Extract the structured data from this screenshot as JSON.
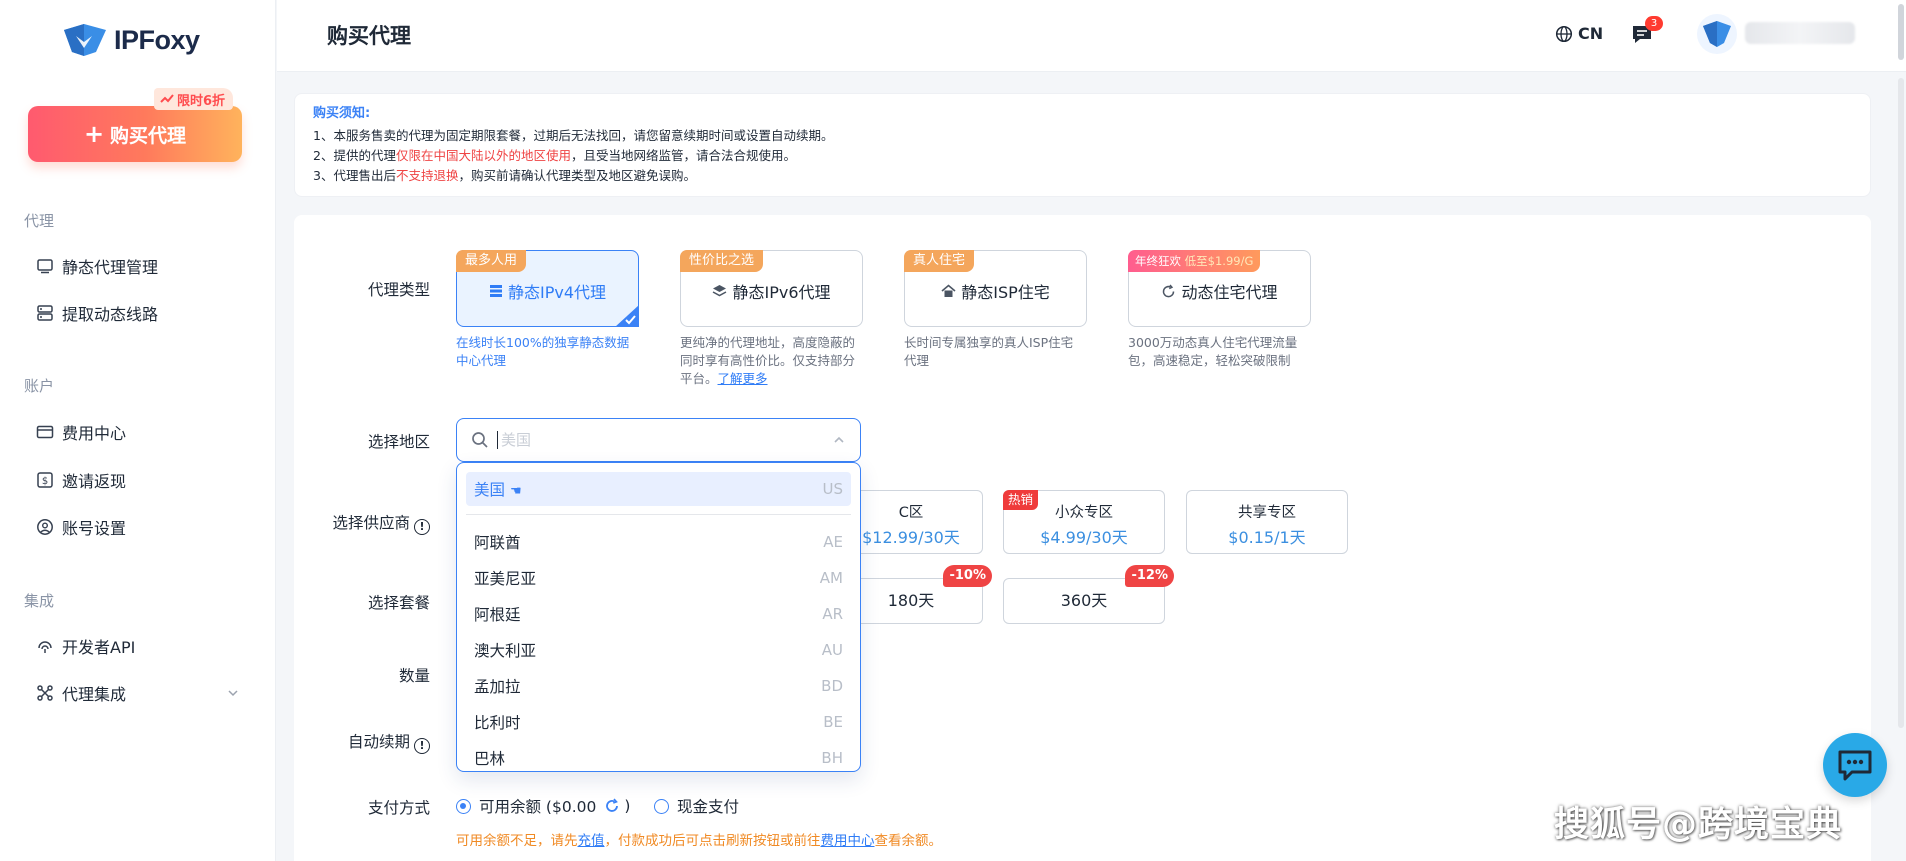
{
  "brand": {
    "name": "IPFoxy"
  },
  "sidebar": {
    "buy_button": "购买代理",
    "promo_tag": "限时6折",
    "sections": [
      {
        "title": "代理",
        "items": [
          {
            "label": "静态代理管理",
            "icon": "monitor-icon"
          },
          {
            "label": "提取动态线路",
            "icon": "server-icon"
          }
        ]
      },
      {
        "title": "账户",
        "items": [
          {
            "label": "费用中心",
            "icon": "card-icon"
          },
          {
            "label": "邀请返现",
            "icon": "dollar-icon"
          },
          {
            "label": "账号设置",
            "icon": "user-icon"
          }
        ]
      },
      {
        "title": "集成",
        "items": [
          {
            "label": "开发者API",
            "icon": "api-icon"
          },
          {
            "label": "代理集成",
            "icon": "integration-icon"
          }
        ]
      }
    ]
  },
  "header": {
    "title": "购买代理",
    "lang": "CN",
    "message_count": "3"
  },
  "notice": {
    "title": "购买须知:",
    "line1": "1、本服务售卖的代理为固定期限套餐，过期后无法找回，请您留意续期时间或设置自动续期。",
    "line2_pre": "2、提供的代理",
    "line2_red": "仅限在中国大陆以外的地区使用",
    "line2_post": "，且受当地网络监管，请合法合规使用。",
    "line3_pre": "3、代理售出后",
    "line3_red": "不支持退换",
    "line3_post": "，购买前请确认代理类型及地区避免误购。"
  },
  "form": {
    "labels": {
      "proxy_type": "代理类型",
      "region": "选择地区",
      "supplier": "选择供应商",
      "plan": "选择套餐",
      "quantity": "数量",
      "auto_renew": "自动续期",
      "payment": "支付方式"
    },
    "proxy_types": [
      {
        "ribbon": "最多人用",
        "title": "静态IPv4代理",
        "desc": "在线时长100%的独享静态数据中心代理"
      },
      {
        "ribbon": "性价比之选",
        "title": "静态IPv6代理",
        "desc": "更纯净的代理地址，高度隐蔽的同时享有高性价比。仅支持部分平台。",
        "link": "了解更多"
      },
      {
        "ribbon": "真人住宅",
        "title": "静态ISP住宅",
        "desc": "长时间专属独享的真人ISP住宅代理"
      },
      {
        "ribbon_a": "年终狂欢",
        "ribbon_b": "低至$1.99/G",
        "title": "动态住宅代理",
        "desc": "3000万动态真人住宅代理流量包，高速稳定，轻松突破限制"
      }
    ],
    "region_placeholder": "美国",
    "region_options": [
      {
        "name": "美国",
        "code": "US"
      },
      {
        "name": "阿联酋",
        "code": "AE"
      },
      {
        "name": "亚美尼亚",
        "code": "AM"
      },
      {
        "name": "阿根廷",
        "code": "AR"
      },
      {
        "name": "澳大利亚",
        "code": "AU"
      },
      {
        "name": "孟加拉",
        "code": "BD"
      },
      {
        "name": "比利时",
        "code": "BE"
      },
      {
        "name": "巴林",
        "code": "BH"
      }
    ],
    "suppliers": [
      {
        "name": "C区",
        "price": "$12.99/30天"
      },
      {
        "name": "小众专区",
        "price": "$4.99/30天",
        "badge": "热销"
      },
      {
        "name": "共享专区",
        "price": "$0.15/1天"
      }
    ],
    "plans": [
      {
        "label": "180天",
        "discount": "-10%"
      },
      {
        "label": "360天",
        "discount": "-12%"
      }
    ],
    "payment": {
      "balance_label": "可用余额 ($0.00",
      "balance_close": ")",
      "cash_label": "现金支付",
      "hint_a": "可用余额不足，请先",
      "hint_link1": "充值",
      "hint_b": "，付款成功后可点击刷新按钮或前往",
      "hint_link2": "费用中心",
      "hint_c": "查看余额。"
    }
  },
  "watermark": "搜狐号@跨境宝典",
  "colors": {
    "accent": "#3b82f6",
    "danger": "#ef4444",
    "warning": "#f08a24"
  }
}
